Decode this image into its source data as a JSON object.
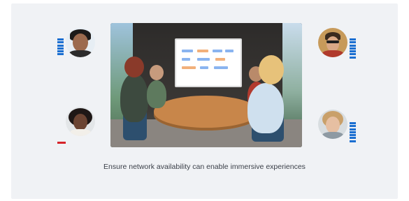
{
  "caption": "Ensure network availability can enable immersive experiences",
  "colors": {
    "card_background": "#f0f2f5",
    "signal_active": "#1b6fd1",
    "signal_muted": "#d6242a",
    "table_wood": "#c8864a"
  },
  "participants": [
    {
      "id": "top-left",
      "signal_bars": 6,
      "status": "active"
    },
    {
      "id": "bottom-left",
      "signal_bars": 1,
      "status": "muted"
    },
    {
      "id": "top-right",
      "signal_bars": 7,
      "status": "active"
    },
    {
      "id": "bottom-right",
      "signal_bars": 7,
      "status": "active"
    }
  ]
}
